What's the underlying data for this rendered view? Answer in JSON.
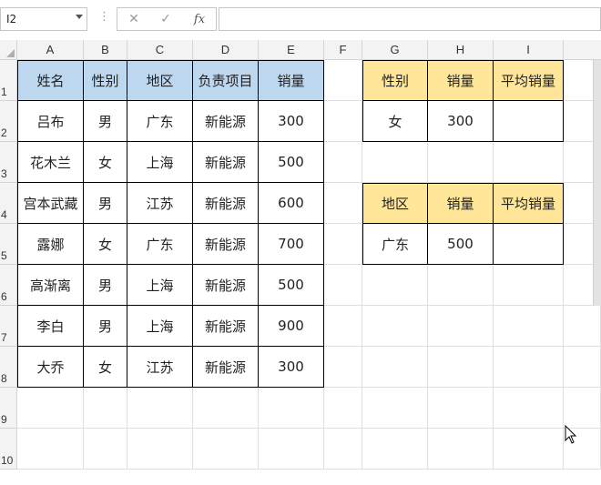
{
  "formula_bar": {
    "name_box": "I2",
    "cancel_icon": "✕",
    "enter_icon": "✓",
    "fx_label": "fx",
    "formula": ""
  },
  "columns": [
    "A",
    "B",
    "C",
    "D",
    "E",
    "F",
    "G",
    "H",
    "I"
  ],
  "rows": [
    "1",
    "2",
    "3",
    "4",
    "5",
    "6",
    "7",
    "8",
    "9",
    "10"
  ],
  "table": {
    "headers": [
      "姓名",
      "性别",
      "地区",
      "负责项目",
      "销量"
    ],
    "rows": [
      [
        "吕布",
        "男",
        "广东",
        "新能源",
        "300"
      ],
      [
        "花木兰",
        "女",
        "上海",
        "新能源",
        "500"
      ],
      [
        "宫本武藏",
        "男",
        "江苏",
        "新能源",
        "600"
      ],
      [
        "露娜",
        "女",
        "广东",
        "新能源",
        "700"
      ],
      [
        "高渐离",
        "男",
        "上海",
        "新能源",
        "500"
      ],
      [
        "李白",
        "男",
        "上海",
        "新能源",
        "900"
      ],
      [
        "大乔",
        "女",
        "江苏",
        "新能源",
        "300"
      ]
    ]
  },
  "lookup1": {
    "headers": [
      "性别",
      "销量",
      "平均销量"
    ],
    "row": [
      "女",
      "300",
      ""
    ]
  },
  "lookup2": {
    "headers": [
      "地区",
      "销量",
      "平均销量"
    ],
    "row": [
      "广东",
      "500",
      ""
    ]
  },
  "colors": {
    "header_blue": "#bdd7ee",
    "header_yellow": "#ffe699"
  }
}
